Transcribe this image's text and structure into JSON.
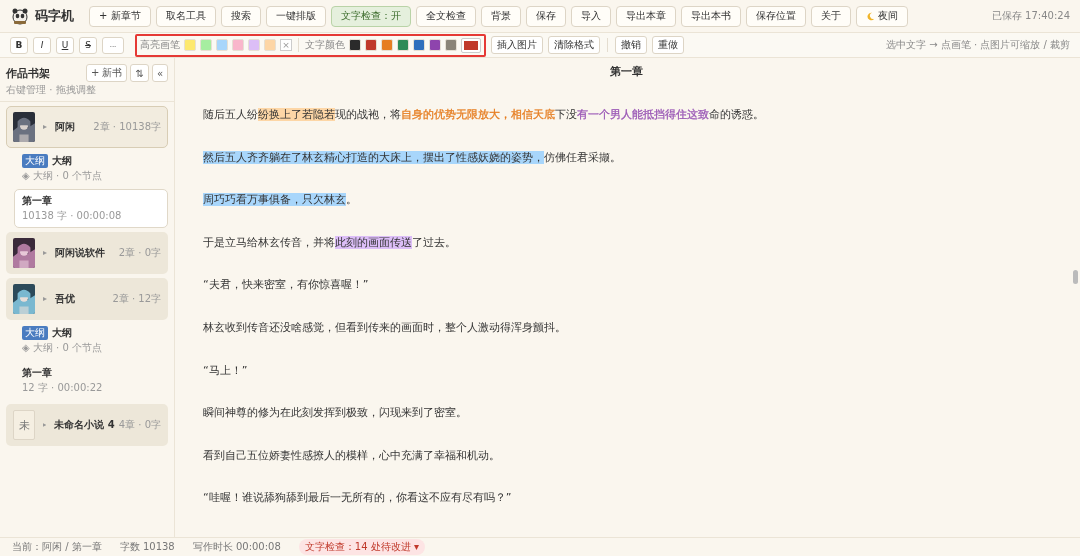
{
  "app": {
    "name": "码字机",
    "saved": "已保存 17:40:24"
  },
  "toolbar": [
    {
      "label": "+ 新章节",
      "kind": "add"
    },
    {
      "label": "取名工具",
      "kind": "plain"
    },
    {
      "label": "搜索",
      "kind": "plain"
    },
    {
      "label": "一键排版",
      "kind": "plain"
    },
    {
      "label": "文字检查：开",
      "kind": "toggle",
      "on": true
    },
    {
      "label": "全文检查",
      "kind": "plain"
    },
    {
      "label": "背景",
      "kind": "plain"
    },
    {
      "label": "保存",
      "kind": "plain"
    },
    {
      "label": "导入",
      "kind": "plain"
    },
    {
      "label": "导出本章",
      "kind": "plain"
    },
    {
      "label": "导出本书",
      "kind": "plain"
    },
    {
      "label": "保存位置",
      "kind": "plain"
    },
    {
      "label": "关于",
      "kind": "plain"
    },
    {
      "label": "夜间",
      "kind": "night"
    }
  ],
  "format": {
    "buttons": [
      {
        "label": "B",
        "kind": "bold"
      },
      {
        "label": "I",
        "kind": "italic"
      },
      {
        "label": "U",
        "kind": "underline"
      },
      {
        "label": "S",
        "kind": "strike"
      },
      {
        "label": "...",
        "kind": "dots"
      }
    ],
    "highlight_label": "高亮画笔",
    "highlights": [
      {
        "color": "#fde96f"
      },
      {
        "color": "#a6eea0"
      },
      {
        "color": "#a8d6fb"
      },
      {
        "color": "#f9b6cb"
      },
      {
        "color": "#dcbef7"
      },
      {
        "color": "#fdd6a6"
      }
    ],
    "clear": "×",
    "text_color_label": "文字颜色",
    "text_colors": [
      {
        "color": "#2b2b2b"
      },
      {
        "color": "#c0392b"
      },
      {
        "color": "#e67e22"
      },
      {
        "color": "#2e8b57"
      },
      {
        "color": "#2f6fbd"
      },
      {
        "color": "#8e44ad"
      },
      {
        "color": "#8a8478"
      }
    ],
    "current_color": {
      "color": "#c0392b"
    },
    "actions": [
      "插入图片",
      "清除格式"
    ],
    "history": [
      "撤销",
      "重做"
    ],
    "hint": "选中文字 → 点画笔 · 点图片可缩放 / 裁剪"
  },
  "sidebar": {
    "title": "作品书架",
    "subtitle": "右键管理 · 拖拽调整",
    "new_book": "+ 新书",
    "sort": "⇅",
    "collapse": "«",
    "books": [
      {
        "title": "阿闲",
        "meta": "2章 · 10138字",
        "selected": true,
        "children": [
          {
            "kind": "outline",
            "tag": "大纲",
            "title": "大纲",
            "meta": "◈ 大纲 · 0 个节点"
          },
          {
            "kind": "chapter",
            "title": "第一章",
            "meta": "10138 字 · 00:00:08",
            "selected": true
          }
        ]
      },
      {
        "title": "阿闲说软件",
        "meta": "2章 · 0字",
        "selected": false
      },
      {
        "title": "吾优",
        "meta": "2章 · 12字",
        "selected": false,
        "children": [
          {
            "kind": "outline",
            "tag": "大纲",
            "title": "大纲",
            "meta": "◈ 大纲 · 0 个节点"
          },
          {
            "kind": "chapter",
            "title": "第一章",
            "meta": "12 字 · 00:00:22",
            "selected": false
          }
        ]
      },
      {
        "title": "未命名小说 4",
        "meta": "4章 · 0字",
        "letter": "未",
        "selected": false
      }
    ]
  },
  "editor": {
    "heading": "第一章",
    "paragraphs": [
      [
        {
          "text": "随后五人纷"
        },
        {
          "text": "纷换上了若隐若",
          "kind": "highlight",
          "color": "#fdd6a6"
        },
        {
          "text": "现的战袍，将"
        },
        {
          "text": "自身的优势无限放大，相信天底",
          "kind": "colored",
          "color": "#e67e22"
        },
        {
          "text": "下没"
        },
        {
          "text": "有一个男人能抵挡得住这致",
          "kind": "colored",
          "color": "#9b59b6"
        },
        {
          "text": "命的诱惑。"
        }
      ],
      [
        {
          "text": "然后五人齐齐躺在了林玄精心打造的大床上，摆出了性感妖娆的姿势，",
          "kind": "highlight",
          "color": "#a8d6fb"
        },
        {
          "text": "仿佛任君采撷。"
        }
      ],
      [
        {
          "text": "周巧巧看万事俱备，只欠林玄",
          "kind": "highlight",
          "color": "#a8d6fb"
        },
        {
          "text": "。"
        }
      ],
      [
        {
          "text": "于是立马给林玄传音，并将"
        },
        {
          "text": "此刻的画面传送",
          "kind": "highlight",
          "color": "#dcbef7"
        },
        {
          "text": "了过去。"
        }
      ],
      [
        {
          "text": "“夫君，快来密室，有你惊喜喔！”"
        }
      ],
      [
        {
          "text": "林玄收到传音还没啥感觉，但看到传来的画面时，整个人激动得浑身颤抖。"
        }
      ],
      [
        {
          "text": "“马上！”"
        }
      ],
      [
        {
          "text": "瞬间神尊的修为在此刻发挥到极致，闪现来到了密室。"
        }
      ],
      [
        {
          "text": "看到自己五位娇妻性感撩人的模样，心中充满了幸福和机动。"
        }
      ],
      [
        {
          "text": "“哇喔！谁说舔狗舔到最后一无所有的，你看这不应有尽有吗？”"
        }
      ]
    ]
  },
  "status_bar": {
    "current": "当前：阿闲 / 第一章",
    "words": "字数 10138",
    "duration": "写作时长 00:00:08",
    "check": "文字检查：14 处待改进 ▾"
  }
}
